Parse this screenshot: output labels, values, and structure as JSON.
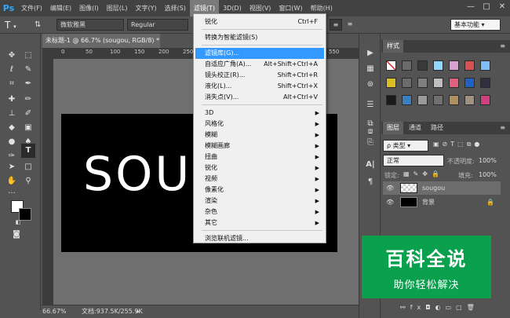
{
  "app": {
    "logo": "Ps"
  },
  "menubar": {
    "items": [
      "文件(F)",
      "编辑(E)",
      "图像(I)",
      "图层(L)",
      "文字(Y)",
      "选择(S)",
      "滤镜(T)",
      "3D(D)",
      "视图(V)",
      "窗口(W)",
      "帮助(H)"
    ],
    "active_index": 6,
    "window_controls": [
      "—",
      "□",
      "✕"
    ]
  },
  "optionsbar": {
    "tool_glyph": "T",
    "font_family": "微软雅黑",
    "font_style": "Regular",
    "workspace": "基本功能"
  },
  "document": {
    "tab_title": "未标题-1 @ 66.7% (sougou, RGB/8) *",
    "ruler_ticks": [
      "0",
      "50",
      "100",
      "150",
      "200",
      "250",
      "300",
      "350",
      "400",
      "450",
      "500",
      "550"
    ],
    "canvas_text": "SOU"
  },
  "statusbar": {
    "zoom": "66.67%",
    "doc_info": "文档:937.5K/255.9K"
  },
  "filter_menu": {
    "items": [
      {
        "label": "锐化",
        "shortcut": "Ctrl+F"
      },
      {
        "sep": true
      },
      {
        "label": "转换为智能滤镜(S)"
      },
      {
        "sep": true
      },
      {
        "label": "滤镜库(G)...",
        "highlighted": true
      },
      {
        "label": "自适应广角(A)...",
        "shortcut": "Alt+Shift+Ctrl+A"
      },
      {
        "label": "镜头校正(R)...",
        "shortcut": "Shift+Ctrl+R"
      },
      {
        "label": "液化(L)...",
        "shortcut": "Shift+Ctrl+X"
      },
      {
        "label": "消失点(V)...",
        "shortcut": "Alt+Ctrl+V"
      },
      {
        "sep": true
      },
      {
        "label": "3D",
        "submenu": true
      },
      {
        "label": "风格化",
        "submenu": true
      },
      {
        "label": "模糊",
        "submenu": true
      },
      {
        "label": "模糊画廊",
        "submenu": true
      },
      {
        "label": "扭曲",
        "submenu": true
      },
      {
        "label": "锐化",
        "submenu": true
      },
      {
        "label": "视频",
        "submenu": true
      },
      {
        "label": "像素化",
        "submenu": true
      },
      {
        "label": "渲染",
        "submenu": true
      },
      {
        "label": "杂色",
        "submenu": true
      },
      {
        "label": "其它",
        "submenu": true
      },
      {
        "sep": true
      },
      {
        "label": "浏览联机滤镜..."
      }
    ]
  },
  "styles_panel": {
    "tab": "样式",
    "swatch_colors": [
      "#ffffff",
      "#6a6a6a",
      "#3a3a3a",
      "#8fd7ff",
      "#d9a0d0",
      "#d95050",
      "#7fbfff",
      "#d9c020",
      "#6c6c6c",
      "#7f7f7f",
      "#bfbfbf",
      "#e06080",
      "#2060c0",
      "#303040",
      "#1a1a1a",
      "#3a80c0",
      "#9a9a9a",
      "#707070",
      "#b09060",
      "#a09080",
      "#d04080"
    ]
  },
  "layers_panel": {
    "tabs": [
      "图层",
      "通道",
      "路径"
    ],
    "filter_kind": "ρ 类型",
    "blend_mode": "正常",
    "opacity_label": "不透明度:",
    "opacity_value": "100%",
    "lock_label": "锁定:",
    "fill_label": "填充:",
    "fill_value": "100%",
    "layers": [
      {
        "name": "sougou",
        "selected": true
      },
      {
        "name": "背景",
        "locked": true
      }
    ]
  },
  "watermark": {
    "title": "百科全说",
    "subtitle": "助你轻松解决"
  }
}
